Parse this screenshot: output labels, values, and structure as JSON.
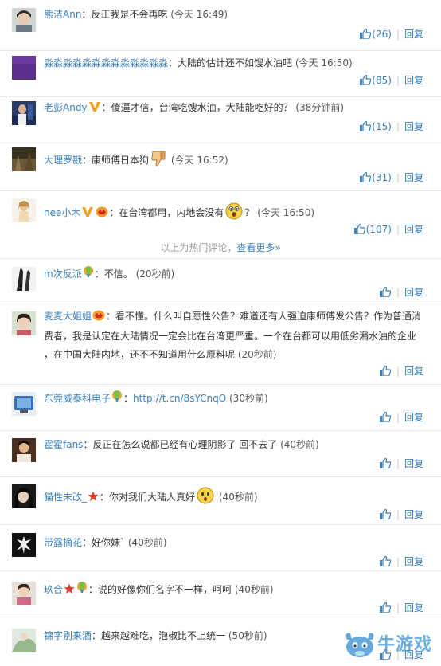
{
  "hot_divider": {
    "text": "以上为热门评论，",
    "more": "查看更多»"
  },
  "reply_label": "回复",
  "watermark": {
    "text": "牛游戏"
  },
  "comments": [
    {
      "user": "熊洁Ann",
      "colon": "：",
      "body": "反正我是不会再吃",
      "time": "(今天 16:49)",
      "likes": "(26)"
    },
    {
      "user": "淼淼淼淼淼淼淼淼淼淼淼淼淼",
      "colon": "：",
      "body": "大陆的估计还不如馊水油吧",
      "time": "(今天 16:50)",
      "likes": "(85)"
    },
    {
      "user": "老彭Andy",
      "colon": "：",
      "body": "傻逼才信，台湾吃馊水油，大陆能吃好的？",
      "time": "(38分钟前)",
      "likes": "(15)"
    },
    {
      "user": "大理罗戡",
      "colon": "：",
      "body": "康师傅日本狗",
      "time": "(今天 16:52)",
      "likes": "(31)"
    },
    {
      "user": "nee小木",
      "colon": "：",
      "body": "在台湾都用，内地会没有",
      "body2": "？",
      "time": "(今天 16:50)",
      "likes": "(107)"
    },
    {
      "user": "m次反派",
      "colon": "：",
      "body": "不信。",
      "time": "(20秒前)",
      "likes": ""
    },
    {
      "user": "麦麦大姐姐",
      "colon": "：",
      "body": "看不懂。什么叫自愿性公告？难道还有人强迫康师傅发公告？作为普通消",
      "line2": "费者，我是认定在大陆情况一定会比在台湾更严重。一个在台都可以用低劣潲水油的企业",
      "line3": "，在中国大陆内地，还不不知道用什么原料呢",
      "time": "(20秒前)",
      "likes": ""
    },
    {
      "user": "东莞威泰科电子",
      "colon": "：",
      "body": "http://t.cn/8sYCnqO",
      "time": "(30秒前)",
      "likes": ""
    },
    {
      "user": "霍霍fans",
      "colon": "：",
      "body": "反正在怎么说都已经有心理阴影了 回不去了",
      "time": "(40秒前)",
      "likes": ""
    },
    {
      "user": "猫性未改_",
      "colon": "：",
      "body": "你对我们大陆人真好",
      "time": "(40秒前)",
      "likes": ""
    },
    {
      "user": "带露摘花",
      "colon": "：",
      "body": "好你妹`",
      "time": "(40秒前)",
      "likes": ""
    },
    {
      "user": "玖合",
      "colon": "：",
      "body": "说的好像你们名字不一样，呵呵",
      "time": "(40秒前)",
      "likes": ""
    },
    {
      "user": "锦字别来酒",
      "colon": "：",
      "body": "越来越难吃，泡椒比不上统一",
      "time": "(50秒前)",
      "likes": ""
    }
  ]
}
